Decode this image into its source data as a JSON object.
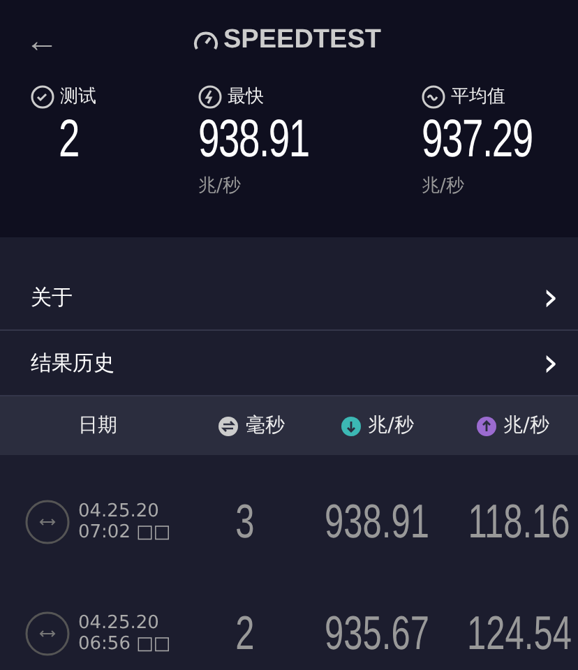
{
  "header": {
    "back": "←",
    "logo": "SPEEDTEST"
  },
  "stats": [
    {
      "kind": "tests",
      "label": "测试",
      "value": "2"
    },
    {
      "kind": "fastest",
      "label": "最快",
      "value": "938.91",
      "unit": "兆/秒"
    },
    {
      "kind": "average",
      "label": "平均值",
      "value": "937.29",
      "unit": "兆/秒"
    }
  ],
  "menu": [
    {
      "label": "关于",
      "chevron": "›"
    },
    {
      "label": "结果历史",
      "chevron": "›"
    }
  ],
  "table": {
    "columns": [
      {
        "kind": "date",
        "label": "日期"
      },
      {
        "kind": "ping",
        "label": "毫秒"
      },
      {
        "kind": "download",
        "label": "兆/秒"
      },
      {
        "kind": "upload",
        "label": "兆/秒"
      }
    ],
    "rows": [
      {
        "date": "04.25.20",
        "time": "07:02 □□",
        "ping": "3",
        "download": "938.91",
        "upload": "118.16"
      },
      {
        "date": "04.25.20",
        "time": "06:56 □□",
        "ping": "2",
        "download": "935.67",
        "upload": "124.54"
      }
    ]
  }
}
